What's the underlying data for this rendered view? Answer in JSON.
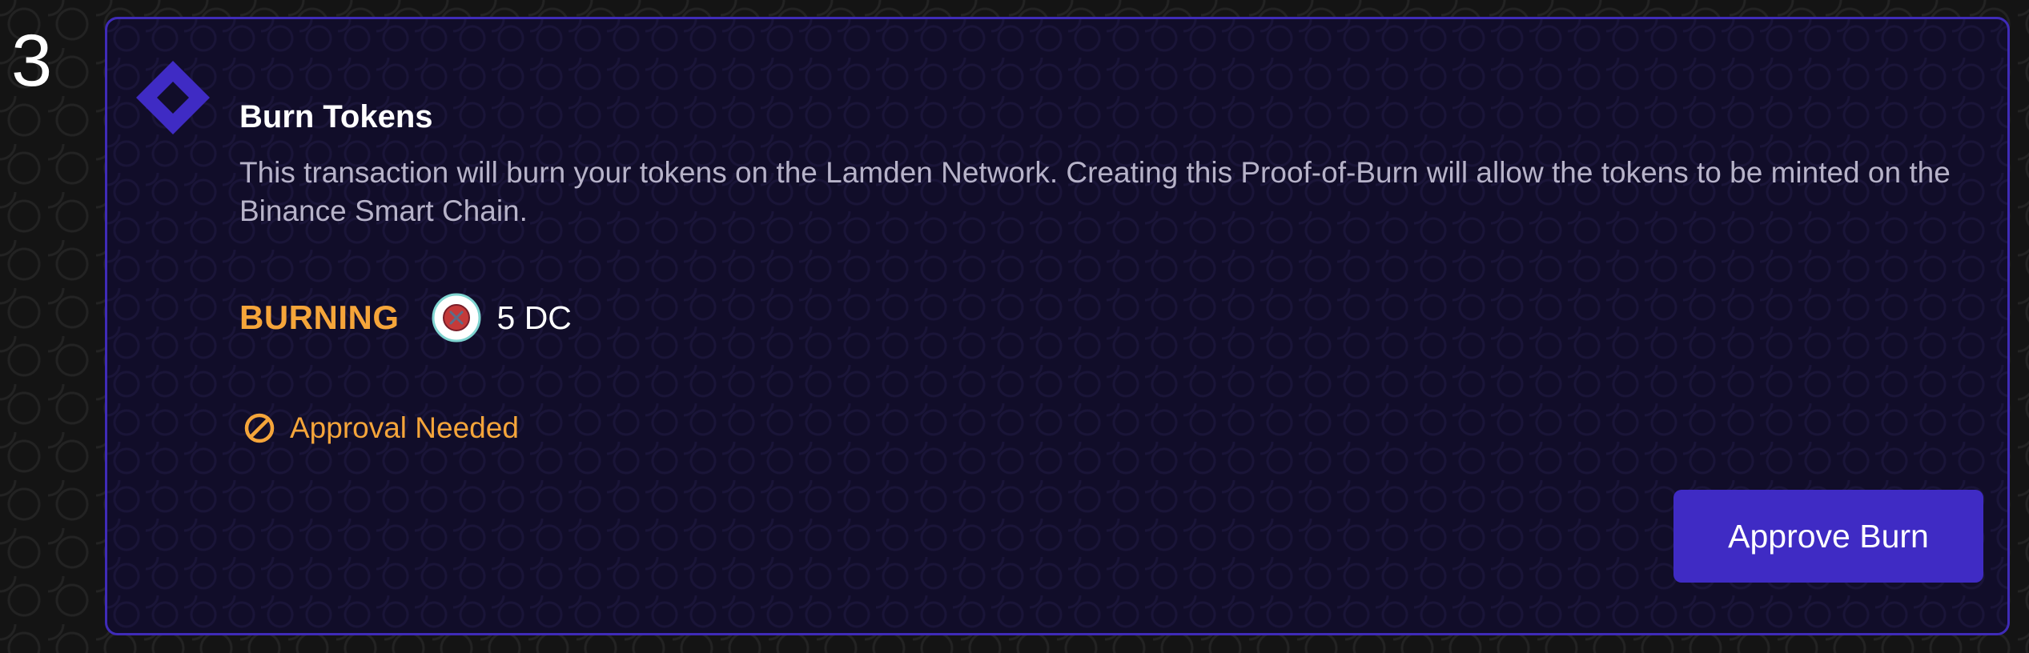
{
  "step": {
    "number": "3"
  },
  "card": {
    "title": "Burn Tokens",
    "description": "This transaction will burn your tokens on the Lamden Network. Creating this Proof-of-Burn will allow the tokens to be minted on the Binance Smart Chain.",
    "burning_label": "BURNING",
    "token_amount": "5 DC",
    "approval_status": "Approval Needed",
    "approve_button_label": "Approve Burn"
  },
  "icons": {
    "step_icon": "diamond-icon",
    "token_icon": "token-logo-icon",
    "status_icon": "ban-icon"
  },
  "colors": {
    "page_background": "#141414",
    "card_background": "#110d29",
    "card_border": "#3f2bb8",
    "accent_purple": "#3f2bc4",
    "warning_orange": "#f5a53a",
    "description_text": "#b7b3c9"
  }
}
